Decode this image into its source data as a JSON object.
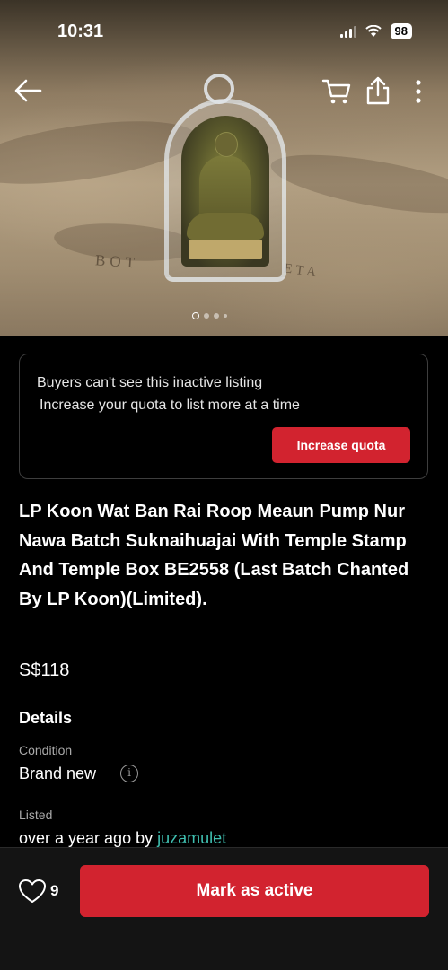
{
  "status_bar": {
    "time": "10:31",
    "battery": "98"
  },
  "icons": {
    "back": "back-arrow-icon",
    "cart": "cart-icon",
    "share": "share-icon",
    "more": "more-vertical-icon",
    "like": "heart-icon",
    "info": "info-icon"
  },
  "photo": {
    "stamp_left": "BOT",
    "stamp_right": "ETA",
    "page_count": 4,
    "current_page": 1
  },
  "notice": {
    "line1": "Buyers can't see this inactive listing",
    "line2": "Increase your quota to list more at a time",
    "button": "Increase quota"
  },
  "listing": {
    "title": "LP Koon Wat Ban Rai Roop Meaun Pump Nur Nawa Batch Suknaihuajai With Temple Stamp And Temple Box BE2558 (Last Batch Chanted By LP Koon)(Limited).",
    "price": "S$118"
  },
  "details": {
    "heading": "Details",
    "condition_label": "Condition",
    "condition_value": "Brand new",
    "listed_label": "Listed",
    "listed_prefix": "over a year ago by ",
    "seller": "juzamulet"
  },
  "bottom": {
    "likes": "9",
    "action_button": "Mark as active"
  },
  "colors": {
    "accent_red": "#d2232f",
    "link_teal": "#3fbfb0",
    "background": "#000000"
  }
}
